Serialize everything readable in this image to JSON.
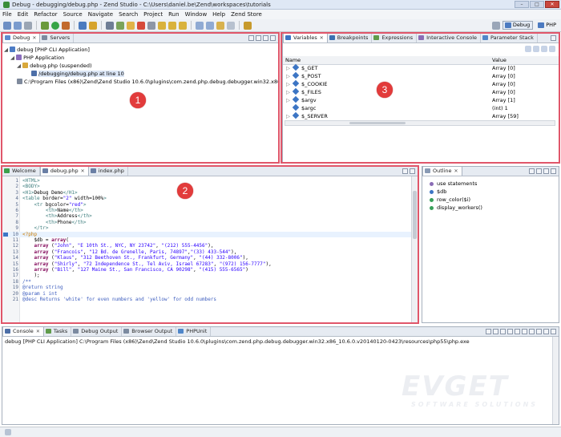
{
  "window": {
    "title": "Debug - debugging/debug.php - Zend Studio - C:\\Users\\daniel.be\\Zend\\workspaces\\tutorials",
    "controls": [
      "–",
      "□",
      "✕"
    ]
  },
  "menu": [
    "File",
    "Edit",
    "Refactor",
    "Source",
    "Navigate",
    "Search",
    "Project",
    "Run",
    "Window",
    "Help",
    "Zend Store"
  ],
  "perspectives": {
    "debug": "Debug",
    "php": "PHP"
  },
  "debug_view": {
    "tabs": [
      {
        "label": "Debug"
      },
      {
        "label": "Servers"
      }
    ],
    "tree": [
      "debug [PHP CLI Application]",
      "PHP Application",
      "debug.php (suspended)",
      "/debugging/debug.php at line 10",
      "C:\\Program Files (x86)\\Zend\\Zend Studio 10.6.0\\plugins\\com.zend.php.debug.debugger.win32.x86_10.6.0.v2"
    ]
  },
  "variables_view": {
    "tabs": [
      {
        "label": "Variables"
      },
      {
        "label": "Breakpoints"
      },
      {
        "label": "Expressions"
      },
      {
        "label": "Interactive Console"
      },
      {
        "label": "Parameter Stack"
      }
    ],
    "columns": {
      "name": "Name",
      "value": "Value"
    },
    "rows": [
      {
        "name": "$_GET",
        "value": "Array [0]"
      },
      {
        "name": "$_POST",
        "value": "Array [0]"
      },
      {
        "name": "$_COOKIE",
        "value": "Array [0]"
      },
      {
        "name": "$_FILES",
        "value": "Array [0]"
      },
      {
        "name": "$argv",
        "value": "Array [1]"
      },
      {
        "name": "$argc",
        "value": "(int) 1"
      },
      {
        "name": "$_SERVER",
        "value": "Array [59]"
      }
    ]
  },
  "editor": {
    "tabs": [
      {
        "label": "Welcome"
      },
      {
        "label": "debug.php"
      },
      {
        "label": "index.php"
      }
    ],
    "current_line": 10,
    "lines": [
      "<HTML>",
      "<BODY>",
      "<H1>Debug Demo</H1>",
      "<table border=\"2\" width=100%>",
      "    <tr bgcolor=\"red\">",
      "        <th>Name</th>",
      "        <th>Address</th>",
      "        <th>Phone</th>",
      "    </tr>",
      "<?php",
      "    $db = array(",
      "    array (\"John\", \"E 10th St., NYC, NY 23742\", \"(212) 555-4456\"),",
      "    array (\"Francois\", \"12 Bd. de Grenelle, Paris, 74897\",\"(33) 433-544\"),",
      "    array (\"Klaus\", \"312 Beethoven St., Frankfurt, Germany\", \"(44) 332-8006\"),",
      "    array (\"Shirly\", \"72 Independence St., Tel Aviv, Israel 67283\", \"(972) 156-7777\"),",
      "    array (\"Bill\", \"127 Maine St., San Francisco, CA 90298\", \"(415) 555-6565\")",
      "    );",
      "/**",
      "@return string",
      "@param i int",
      "@desc Returns 'white' for even numbers and 'yellow' for odd numbers"
    ]
  },
  "outline_view": {
    "tab": "Outline",
    "items": [
      "use statements",
      "$db",
      "row_color($i)",
      "display_workers()"
    ]
  },
  "console_view": {
    "tabs": [
      {
        "label": "Console"
      },
      {
        "label": "Tasks"
      },
      {
        "label": "Debug Output"
      },
      {
        "label": "Browser Output"
      },
      {
        "label": "PHPUnit"
      }
    ],
    "text": "debug [PHP CLI Application] C:\\Program Files (x86)\\Zend\\Zend Studio 10.6.0\\plugins\\com.zend.php.debug.debugger.win32.x86_10.6.0.v20140120-0423\\resources\\php55\\php.exe"
  },
  "annotations": [
    "1",
    "2",
    "3"
  ],
  "watermark": {
    "main": "EVGET",
    "sub": "SOFTWARE SOLUTIONS"
  },
  "colors": {
    "highlight": "#e0566a",
    "badge": "#e23b3b",
    "chrome": "#e6ebf2"
  }
}
